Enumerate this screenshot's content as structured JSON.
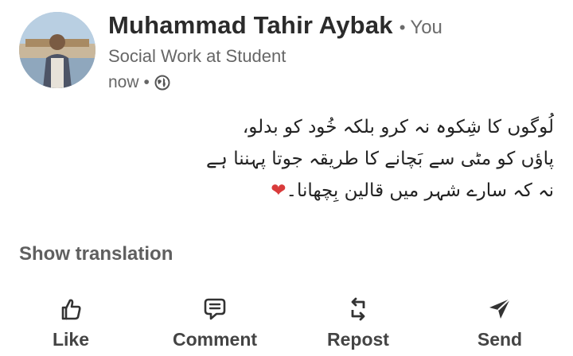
{
  "author": {
    "name": "Muhammad Tahir Aybak",
    "relation": "You",
    "separator": "•",
    "headline": "Social Work at Student",
    "time": "now",
    "visibility_icon": "globe-icon"
  },
  "post": {
    "lines": [
      "لُوگوں کا شِکوہ نہ کرو بلکہ خُود کو بدلو،",
      "پاؤں کو مٹی سے بَچانے کا طریقہ جوتا پہننا ہے",
      "نہ کہ سارے شہر میں قالین بِچھانا۔"
    ],
    "emoji": "❤"
  },
  "show_translation": "Show translation",
  "actions": [
    {
      "label": "Like",
      "icon": "thumbs-up-icon"
    },
    {
      "label": "Comment",
      "icon": "comment-icon"
    },
    {
      "label": "Repost",
      "icon": "repost-icon"
    },
    {
      "label": "Send",
      "icon": "send-icon"
    }
  ],
  "colors": {
    "text": "#2b2b2b",
    "muted": "#666666",
    "heart": "#d93b3b"
  }
}
